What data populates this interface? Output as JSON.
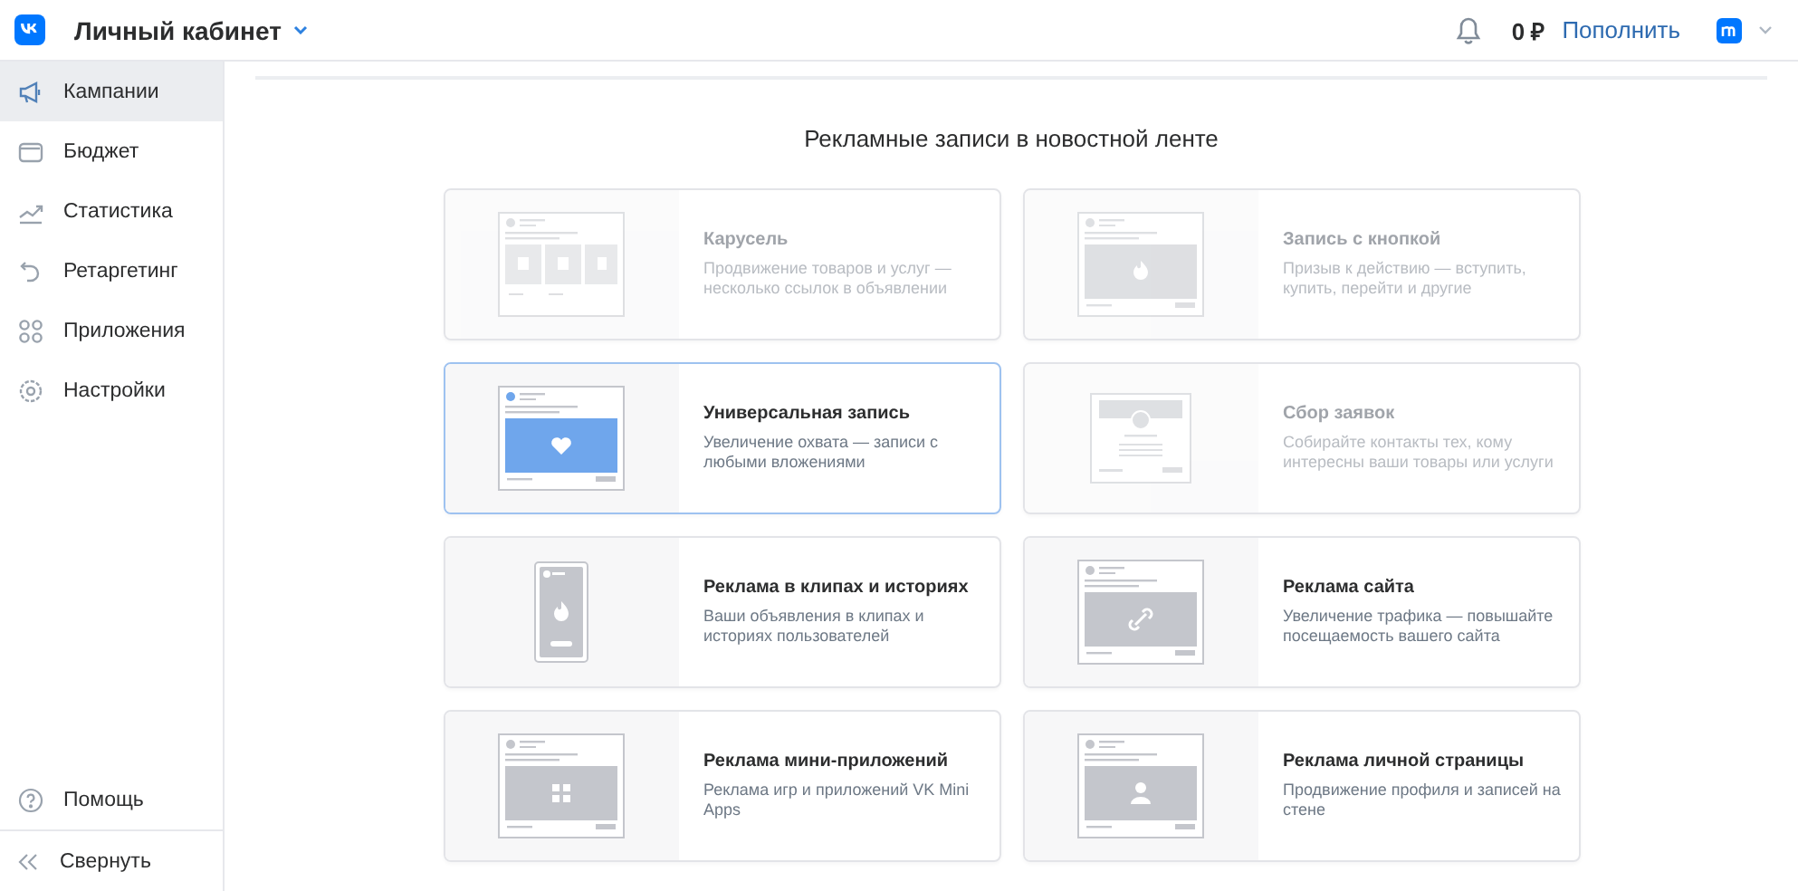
{
  "header": {
    "title": "Личный кабинет",
    "balance": "0 ₽",
    "top_up": "Пополнить"
  },
  "sidebar": {
    "items": [
      {
        "label": "Кампании",
        "selected": true
      },
      {
        "label": "Бюджет",
        "selected": false
      },
      {
        "label": "Статистика",
        "selected": false
      },
      {
        "label": "Ретаргетинг",
        "selected": false
      },
      {
        "label": "Приложения",
        "selected": false
      },
      {
        "label": "Настройки",
        "selected": false
      }
    ],
    "help": "Помощь",
    "collapse": "Свернуть"
  },
  "section_title": "Рекламные записи в новостной ленте",
  "cards": [
    {
      "kind": "carousel",
      "title": "Карусель",
      "description": "Продвижение товаров и услуг — несколько ссылок в объявлении",
      "disabled": true,
      "selected": false
    },
    {
      "kind": "button",
      "title": "Запись с кнопкой",
      "description": "Призыв к действию — вступить, купить, перейти и другие",
      "disabled": true,
      "selected": false
    },
    {
      "kind": "universal",
      "title": "Универсальная запись",
      "description": "Увеличение охвата — записи с любыми вложениями",
      "disabled": false,
      "selected": true
    },
    {
      "kind": "leads",
      "title": "Сбор заявок",
      "description": "Собирайте контакты тех, кому интересны ваши товары или услуги",
      "disabled": true,
      "selected": false
    },
    {
      "kind": "clips",
      "title": "Реклама в клипах и историях",
      "description": "Ваши объявления в клипах и историях пользователей",
      "disabled": false,
      "selected": false
    },
    {
      "kind": "site",
      "title": "Реклама сайта",
      "description": "Увеличение трафика — повышайте посещаемость вашего сайта",
      "disabled": false,
      "selected": false
    },
    {
      "kind": "mini_apps",
      "title": "Реклама мини-приложений",
      "description": "Реклама игр и приложений VK Mini Apps",
      "disabled": false,
      "selected": false
    },
    {
      "kind": "profile",
      "title": "Реклама личной страницы",
      "description": "Продвижение профиля и записей на стене",
      "disabled": false,
      "selected": false
    }
  ]
}
